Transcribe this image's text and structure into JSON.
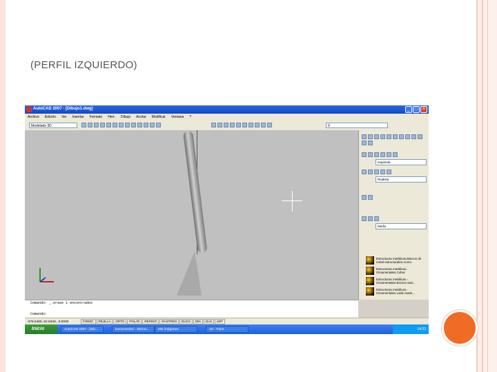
{
  "slide": {
    "title": "(PERFIL IZQUIERDO)"
  },
  "window": {
    "title": "AutoCAD 2007 - [Dibujo1.dwg]"
  },
  "menu": [
    "Archivo",
    "Edición",
    "Ver",
    "Insertar",
    "Formato",
    "Herr.",
    "Dibujo",
    "Acotar",
    "Modificar",
    "Ventana",
    "?"
  ],
  "toolbar": {
    "workspace": "Modelado 3D",
    "layer": "0"
  },
  "palette": {
    "view_select": "Izquierda",
    "visual_style": "Realista",
    "light_select": "Medio"
  },
  "materials": [
    "Estructuras metálicas.Marcos de metal estructurales.Acero",
    "Estructuras metálicas.-Ornamentales.Cobre",
    "Estructuras metálicas.-Ornamentales.Bronce.Sati...",
    "Estructuras metálicas.-Ornamentales.Latón.Satin..."
  ],
  "command": {
    "line1": "Comando: _.erase 1 encontrados",
    "line2": "",
    "line3": "Comando:"
  },
  "status": {
    "coords": "-376.5480, 62.5349 , 0.0000",
    "buttons": [
      "FORZC",
      "REJILLA",
      "ORTO",
      "POLAR",
      "REFENT",
      "RASTREO",
      "DUCS",
      "DIN",
      "GLN",
      "LWT"
    ]
  },
  "taskbar": {
    "start": "Inicio",
    "tasks": [
      "AutoCAD 2007 - [Dib...",
      "Documento1 - Micros...",
      "Mis imágenes",
      "2D - Paint"
    ],
    "clock": "14:33"
  }
}
